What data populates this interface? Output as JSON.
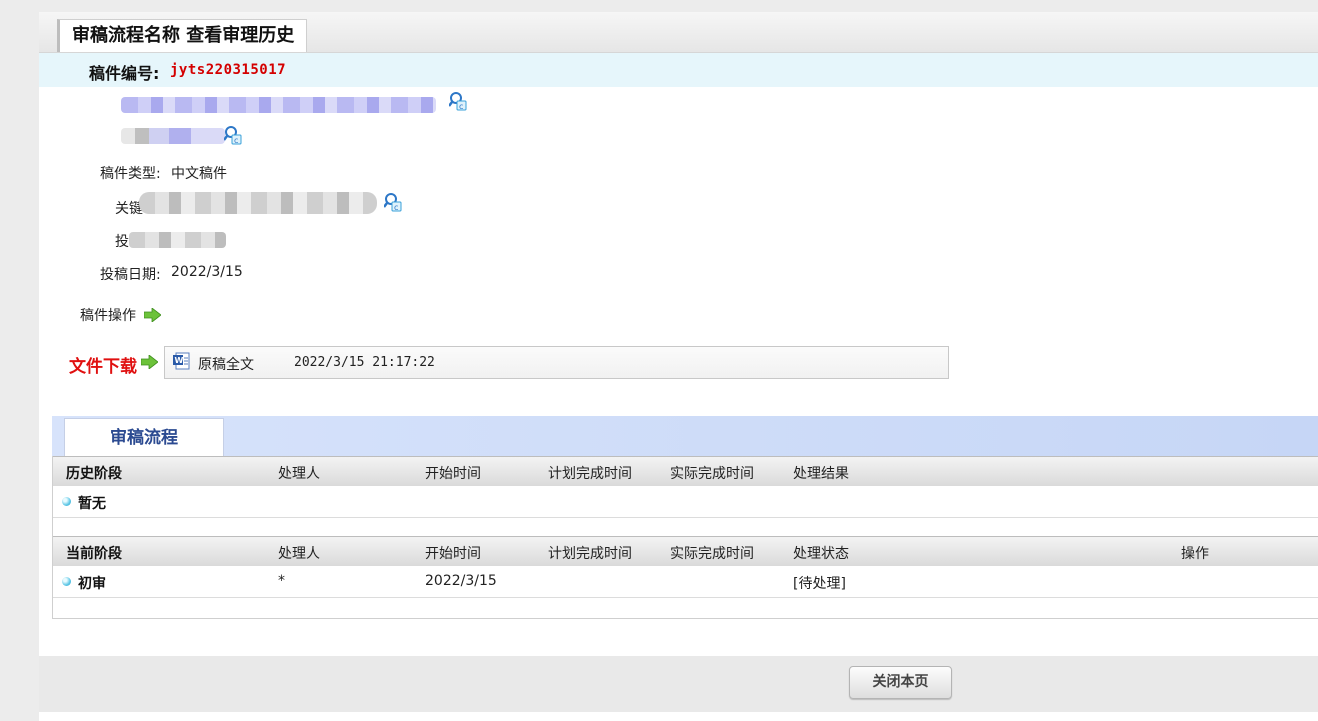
{
  "header": {
    "tab_title": "审稿流程名称 查看审理历史"
  },
  "manuscript": {
    "id_label": "稿件编号:",
    "id_value": "jyts220315017",
    "type_label": "稿件类型:",
    "type_value": "中文稿件",
    "keyword_label_partial": "关键",
    "submitter_label_partial": "投",
    "date_label": "投稿日期:",
    "date_value": "2022/3/15"
  },
  "operations": {
    "label": "稿件操作"
  },
  "download": {
    "label": "文件下载",
    "file_name": "原稿全文",
    "file_time": "2022/3/15 21:17:22"
  },
  "flow": {
    "tab_label": "审稿流程",
    "history_headers": [
      "历史阶段",
      "处理人",
      "开始时间",
      "计划完成时间",
      "实际完成时间",
      "处理结果"
    ],
    "history_empty": "暂无",
    "current_headers": [
      "当前阶段",
      "处理人",
      "开始时间",
      "计划完成时间",
      "实际完成时间",
      "处理状态",
      "操作"
    ],
    "current_row": {
      "stage": "初审",
      "handler": "*",
      "start": "2022/3/15",
      "planned": "",
      "actual": "",
      "status": "[待处理]",
      "action": ""
    }
  },
  "footer": {
    "close_button": "关闭本页"
  },
  "colors": {
    "accent_red": "#d40000",
    "flow_tab_text": "#2b4a91",
    "id_row_bg": "#e6f6fb",
    "arrow_green": "#6cc23a"
  },
  "icons": [
    "search-icon",
    "right-arrow-icon",
    "word-document-icon",
    "bullet-icon"
  ]
}
